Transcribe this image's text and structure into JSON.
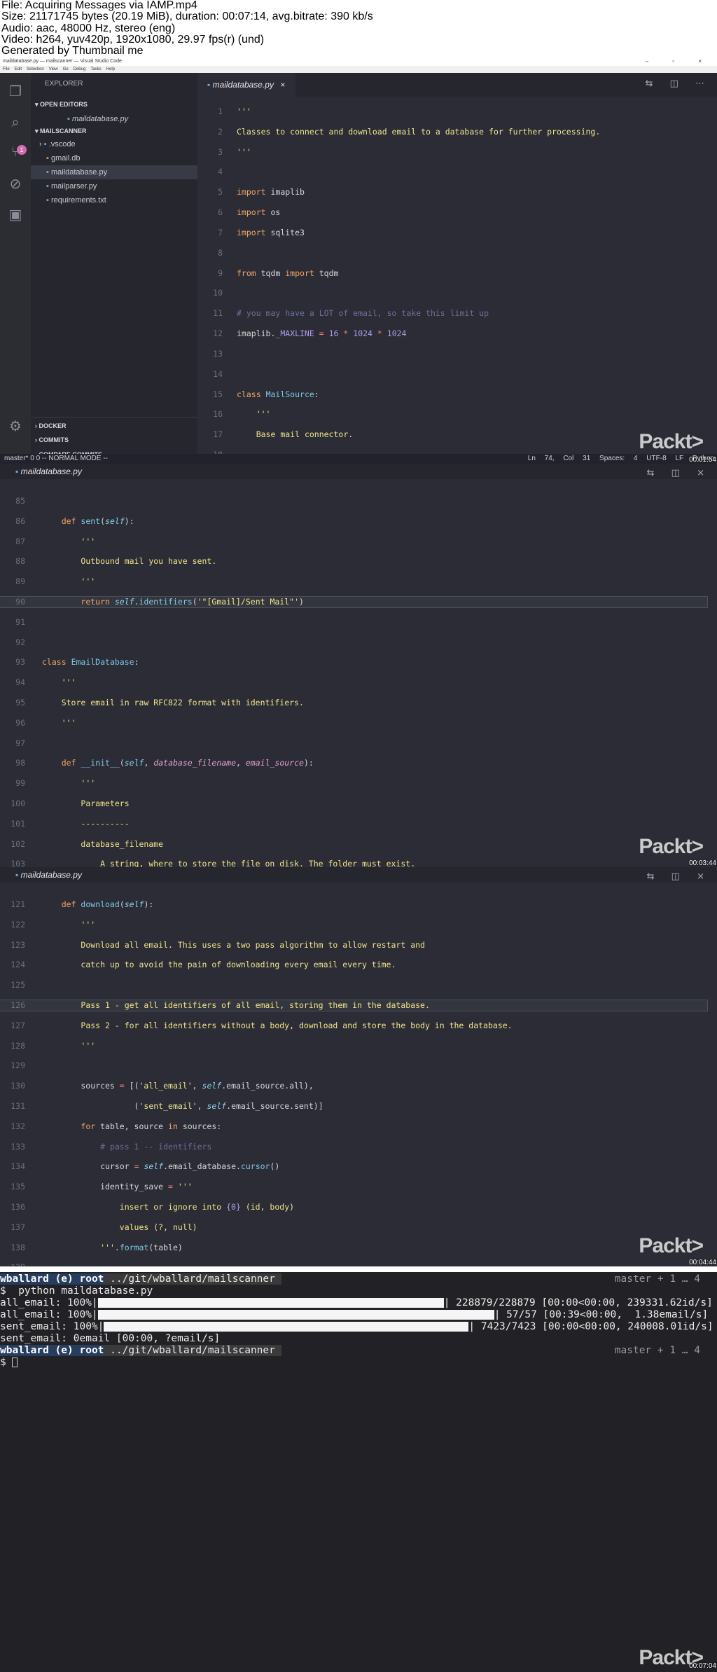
{
  "header": {
    "line1": "File: Acquiring Messages via IAMP.mp4",
    "line2": "Size: 21171745 bytes (20.19 MiB), duration: 00:07:14, avg.bitrate: 390 kb/s",
    "line3": "Audio: aac, 48000 Hz, stereo (eng)",
    "line4": "Video: h264, yuv420p, 1920x1080, 29.97 fps(r) (und)",
    "line5": "Generated by Thumbnail me"
  },
  "frame1": {
    "window_title": "maildatabase.py — mailscanner — Visual Studio Code",
    "menu": [
      "File",
      "Edit",
      "Selection",
      "View",
      "Go",
      "Debug",
      "Tasks",
      "Help"
    ],
    "badge": "1",
    "explorer_title": "EXPLORER",
    "open_editors": "OPEN EDITORS",
    "open_file": "maildatabase.py",
    "project": "MAILSCANNER",
    "files": [
      ".vscode",
      "gmail.db",
      "maildatabase.py",
      "mailparser.py",
      "requirements.txt"
    ],
    "bottom_sections": [
      "DOCKER",
      "COMMITS",
      "COMPARE COMMITS"
    ],
    "tab": "maildatabase.py",
    "status_left": "master*   0  0    -- NORMAL MODE --",
    "status_right": "Ln 74, Col 31  Spaces: 4  UTF-8  LF  Python",
    "timestamp": "00:01:54",
    "logo": "Packt>"
  },
  "frame2": {
    "tab": "maildatabase.py",
    "timestamp": "00:03:44",
    "logo": "Packt>"
  },
  "frame3": {
    "tab": "maildatabase.py",
    "timestamp": "00:04:44",
    "logo": "Packt>"
  },
  "terminal": {
    "user": "wballard",
    "env": "(e) root",
    "path": "../git/wballard/mailscanner",
    "git": "master + 1 … 4",
    "command": "$  python maildatabase.py",
    "rows": [
      {
        "label": "all_email: 100%|",
        "bar": "",
        "stats": "| 228879/228879 [00:00<00:00, 239331.62id/s]"
      },
      {
        "label": "all_email: 100%|",
        "bar": "",
        "stats": "| 57/57 [00:39<00:00,  1.38email/s]"
      },
      {
        "label": "sent_email: 100%|",
        "bar": "",
        "stats": "| 7423/7423 [00:00<00:00, 240008.01id/s]"
      },
      {
        "label": "sent_email: 0email [00:00, ?email/s]",
        "bar": "",
        "stats": ""
      }
    ],
    "prompt2": "$ ",
    "timestamp": "00:07:04",
    "logo": "Packt>"
  }
}
